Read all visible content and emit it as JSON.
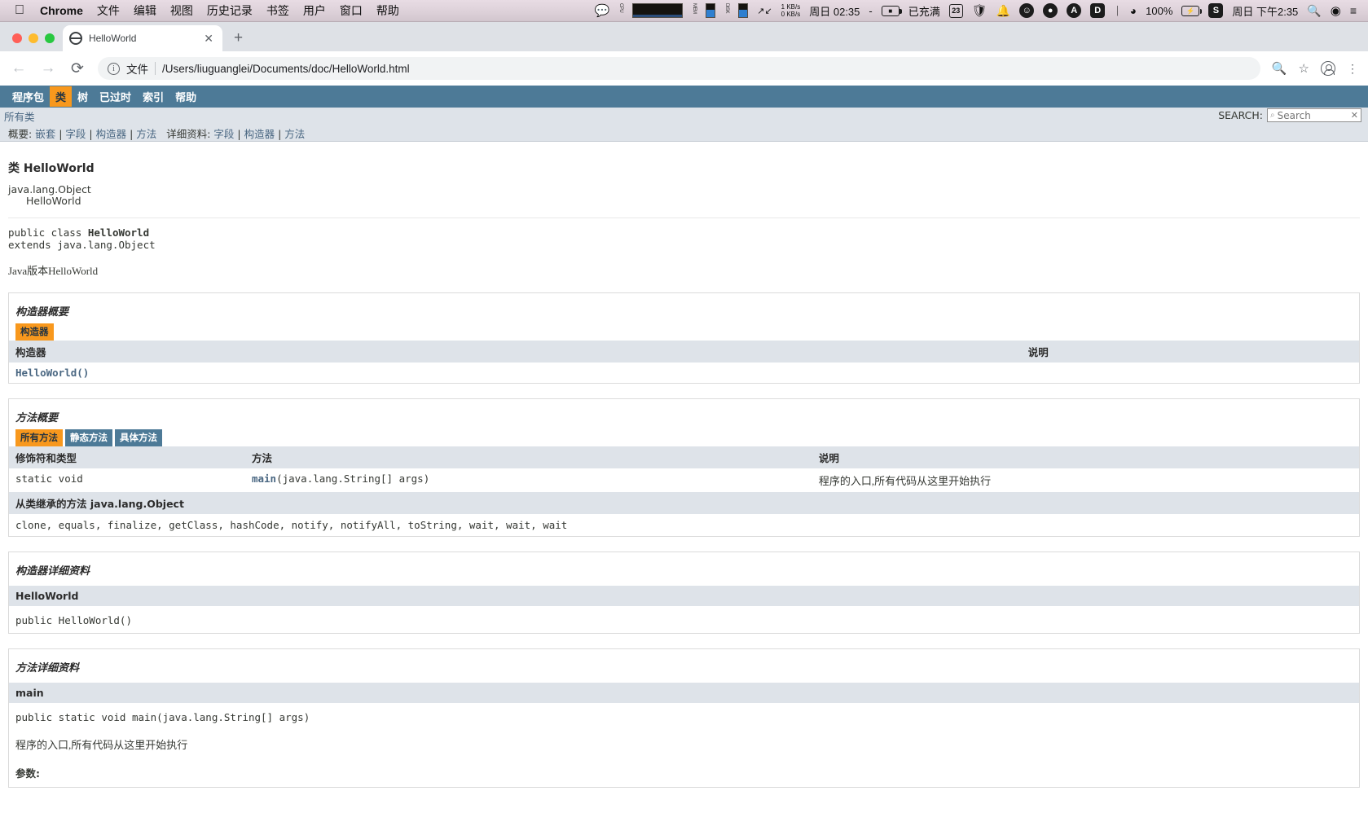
{
  "menubar": {
    "apple_icon": "apple-icon",
    "app": "Chrome",
    "items": [
      "文件",
      "编辑",
      "视图",
      "历史记录",
      "书签",
      "用户",
      "窗口",
      "帮助"
    ],
    "status": {
      "wechat_icon": "wechat-icon",
      "cpu_label": "CPU",
      "mem_label": "MEM",
      "disk_label": "DISK",
      "arrows_icon": "network-arrows-icon",
      "net_up": "1 KB/s",
      "net_down": "0 KB/s",
      "clock_left": "周日 02:35",
      "dash": "-",
      "battery_icon": "battery-charging-icon",
      "battery_text": "已充满",
      "calendar": "23",
      "shield_icon": "shield-icon",
      "bell_icon": "bell-icon",
      "smiley_icon": "smiley-icon",
      "mic_icon": "microphone-icon",
      "a_icon": "input-source-a-icon",
      "d_icon": "d-app-icon",
      "bluetooth_icon": "bluetooth-icon",
      "wifi_icon": "wifi-icon",
      "battery_percent": "100%",
      "battery_icon2": "battery-icon",
      "sogou_icon": "sogou-input-icon",
      "clock_right": "周日 下午2:35",
      "search_icon": "spotlight-search-icon",
      "siri_icon": "siri-icon",
      "control_center_icon": "control-center-icon"
    }
  },
  "browser": {
    "window_controls": [
      "close",
      "minimize",
      "maximize"
    ],
    "tab": {
      "title": "HelloWorld",
      "favicon": "globe-icon",
      "close_label": "✕"
    },
    "newtab_label": "+",
    "back_label": "←",
    "forward_label": "→",
    "reload_label": "⟳",
    "omnibox": {
      "scheme_label": "文件",
      "url": "/Users/liuguanglei/Documents/doc/HelloWorld.html",
      "info_icon": "info-icon"
    },
    "zoom_icon": "search-page-icon",
    "bookmark_icon": "star-icon",
    "profile_icon": "profile-avatar-icon",
    "menu_icon": "chrome-menu-icon"
  },
  "javadoc": {
    "topnav": [
      {
        "label": "程序包",
        "active": false
      },
      {
        "label": "类",
        "active": true
      },
      {
        "label": "树",
        "active": false
      },
      {
        "label": "已过时",
        "active": false
      },
      {
        "label": "索引",
        "active": false
      },
      {
        "label": "帮助",
        "active": false
      }
    ],
    "allclasses": "所有类",
    "summary_prefix": "概要:",
    "summary_links": [
      "嵌套",
      "字段",
      "构造器",
      "方法"
    ],
    "detail_prefix": "详细资料:",
    "detail_links": [
      "字段",
      "构造器",
      "方法"
    ],
    "search": {
      "label": "SEARCH:",
      "placeholder": "Search",
      "magnifier_icon": "magnifier-icon",
      "clear_icon": "clear-icon"
    },
    "class_header": "类 HelloWorld",
    "inheritance": [
      "java.lang.Object",
      "HelloWorld"
    ],
    "declaration_line1_prefix": "public class ",
    "declaration_line1_name": "HelloWorld",
    "declaration_line2": "extends java.lang.Object",
    "class_description": "Java版本HelloWorld",
    "constructor_summary": {
      "title": "构造器概要",
      "tab": "构造器",
      "col_header_1": "构造器",
      "col_header_2": "说明",
      "rows": [
        {
          "constructor": "HelloWorld()",
          "description": ""
        }
      ]
    },
    "method_summary": {
      "title": "方法概要",
      "tabs": [
        {
          "label": "所有方法",
          "active": true
        },
        {
          "label": "静态方法",
          "active": false
        },
        {
          "label": "具体方法",
          "active": false
        }
      ],
      "col_header_1": "修饰符和类型",
      "col_header_2": "方法",
      "col_header_3": "说明",
      "rows": [
        {
          "modifier": "static void",
          "method_link": "main",
          "method_args": "(java.lang.String[] args)",
          "description": "程序的入口,所有代码从这里开始执行"
        }
      ],
      "inherited_label": "从类继承的方法 ",
      "inherited_class": "java.lang.Object",
      "inherited_methods": "clone, equals, finalize, getClass, hashCode, notify, notifyAll, toString, wait, wait, wait"
    },
    "constructor_detail": {
      "title": "构造器详细资料",
      "name": "HelloWorld",
      "signature": "public HelloWorld()"
    },
    "method_detail": {
      "title": "方法详细资料",
      "name": "main",
      "signature": "public static void main(java.lang.String[] args)",
      "description": "程序的入口,所有代码从这里开始执行",
      "params_label": "参数:"
    }
  },
  "colors": {
    "javadoc_nav_bg": "#4d7a97",
    "javadoc_active_tab": "#f8981d",
    "javadoc_subnav_bg": "#dee3e9",
    "link": "#4a6782"
  }
}
